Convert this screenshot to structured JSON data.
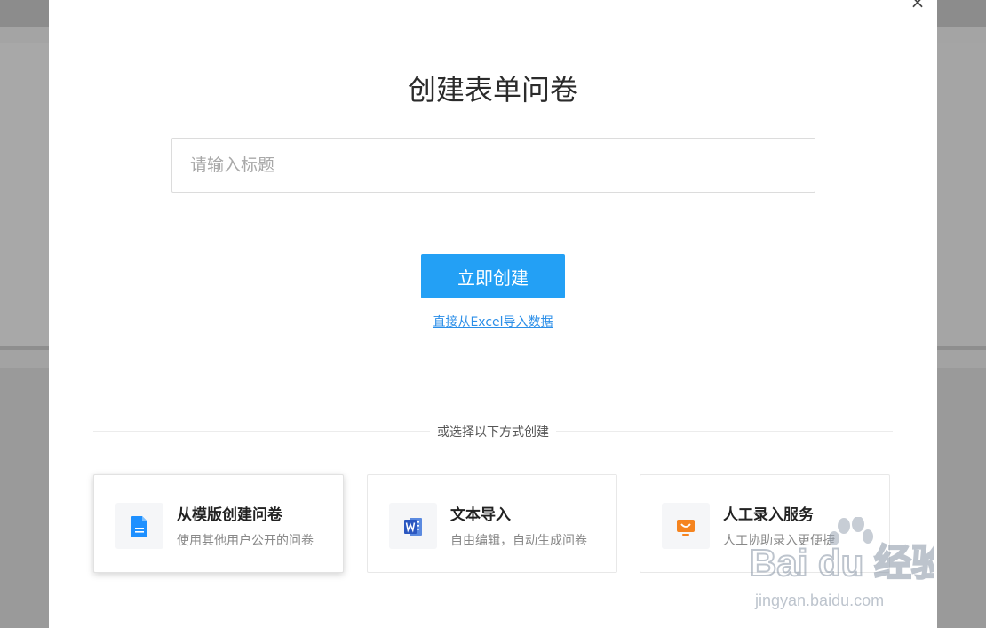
{
  "modal": {
    "close_icon": "×",
    "title": "创建表单问卷",
    "title_input": {
      "placeholder": "请输入标题",
      "value": ""
    },
    "create_button": "立即创建",
    "excel_import_link": "直接从Excel导入数据",
    "divider_text": "或选择以下方式创建",
    "options": [
      {
        "icon": "document-icon",
        "title": "从模版创建问卷",
        "desc": "使用其他用户公开的问卷",
        "accent": "#1e90ff"
      },
      {
        "icon": "word-icon",
        "title": "文本导入",
        "desc": "自由编辑，自动生成问卷",
        "accent": "#2b63c6"
      },
      {
        "icon": "service-icon",
        "title": "人工录入服务",
        "desc": "人工协助录入更便捷",
        "accent": "#f5841f"
      }
    ]
  },
  "watermark": {
    "brand": "Bai du 经验",
    "url": "jingyan.baidu.com"
  },
  "colors": {
    "primary": "#23a0f5",
    "link": "#2a8ee8"
  }
}
